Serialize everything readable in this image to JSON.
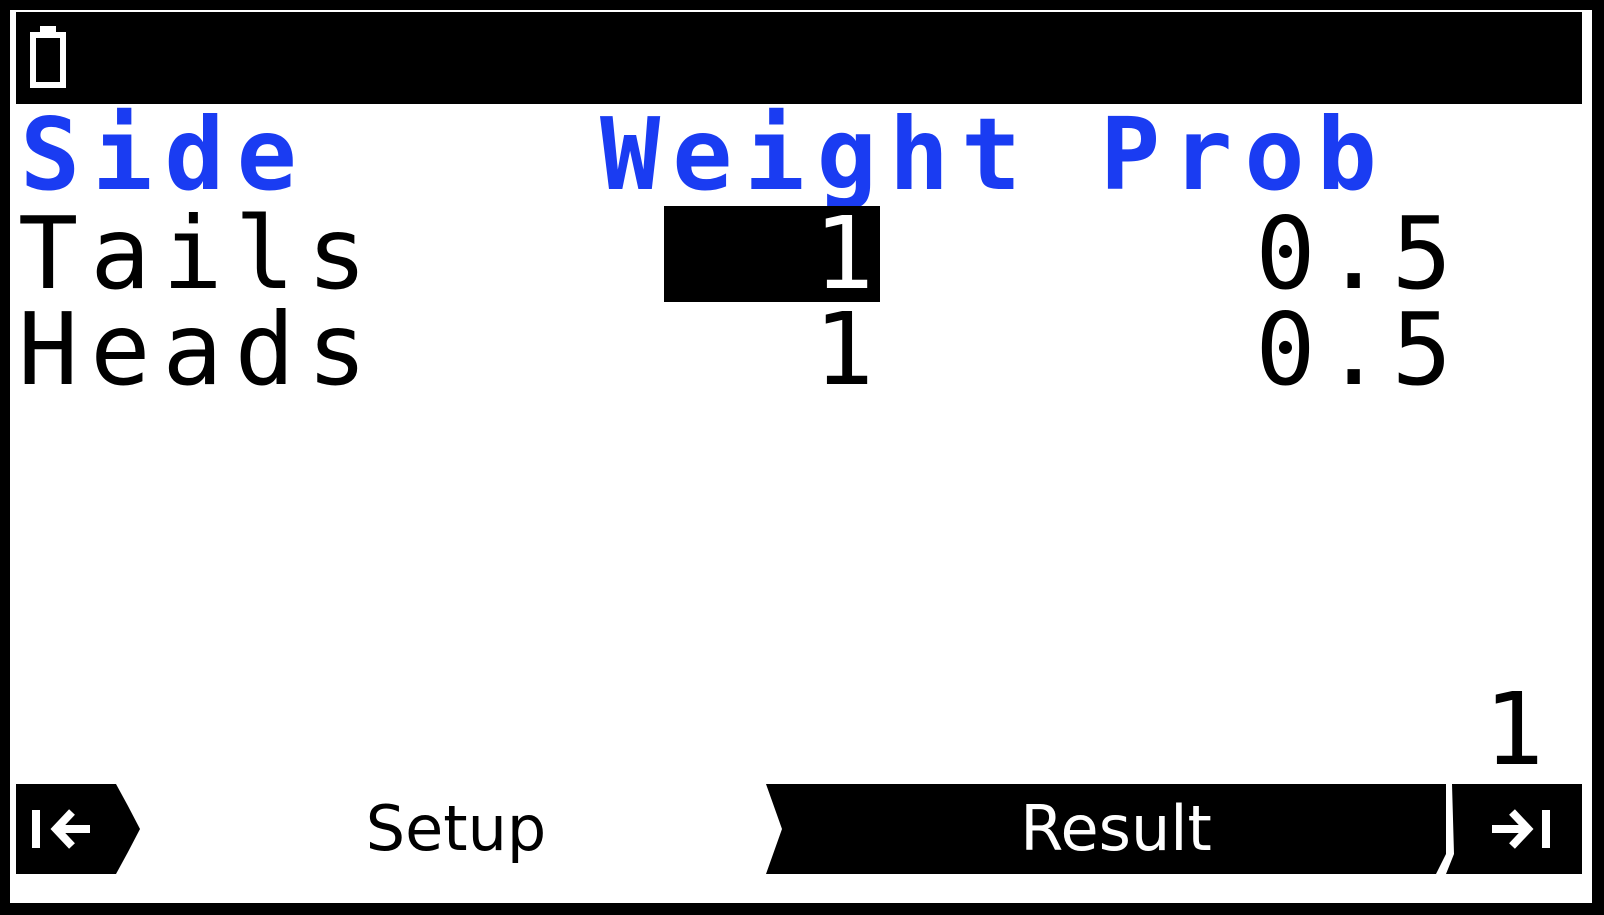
{
  "status_bar": {
    "battery_icon": "battery-icon"
  },
  "table": {
    "columns": [
      "Side",
      "Weight",
      "Prob"
    ],
    "rows": [
      {
        "side": "Tails",
        "weight": "1",
        "prob": "0.5"
      },
      {
        "side": "Heads",
        "weight": "1",
        "prob": "0.5"
      }
    ],
    "selected_cell": {
      "row": 0,
      "column": "Weight"
    }
  },
  "row_counter": "1",
  "tabs": {
    "first_icon": "first-page-icon",
    "setup_label": "Setup",
    "result_label": "Result",
    "last_icon": "last-page-icon",
    "active": "Result"
  },
  "colors": {
    "header": "#1a3cf2",
    "background": "#ffffff",
    "frame": "#000000"
  }
}
